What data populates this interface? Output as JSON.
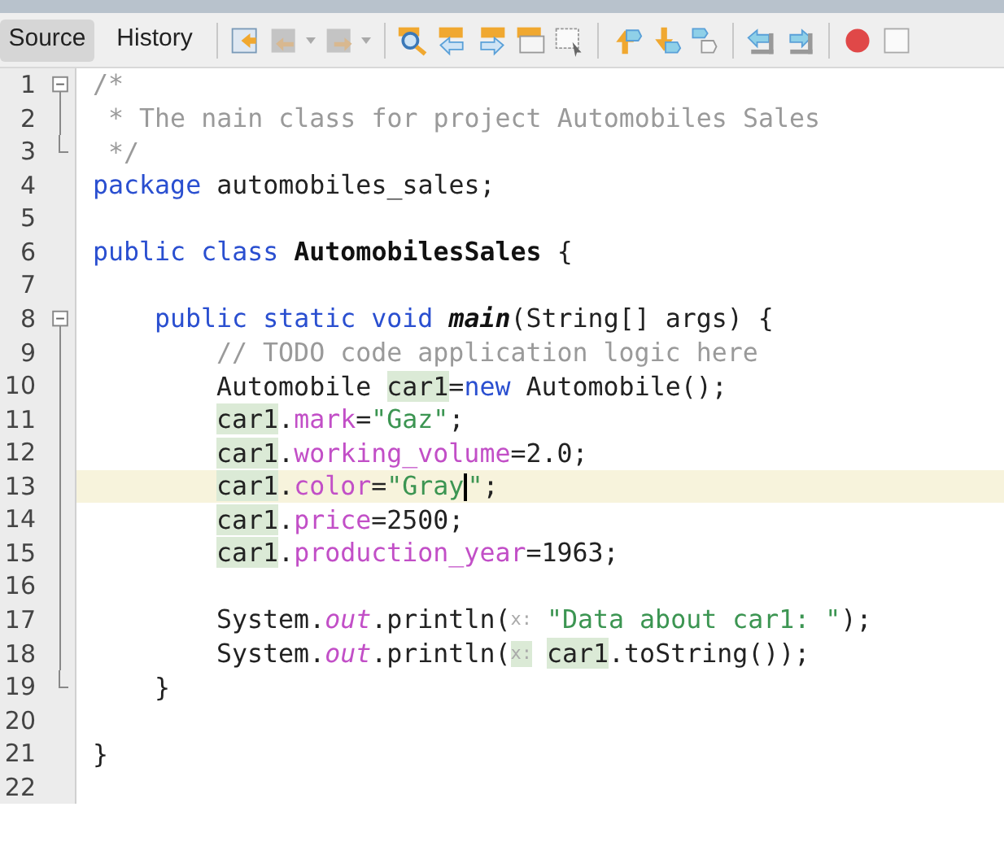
{
  "tabs": [
    {
      "label": "Source",
      "selected": true
    },
    {
      "label": "History",
      "selected": false
    }
  ],
  "toolbar": {
    "back_disabled": true,
    "forward_disabled": true,
    "record_active": true
  },
  "lines": [
    {
      "number": "1",
      "fold_start": true,
      "selected": false,
      "tokens": [
        {
          "kind": "comment",
          "text": "/*"
        }
      ]
    },
    {
      "number": "2",
      "selected": false,
      "tokens": [
        {
          "kind": "comment",
          "text": " * The nain class for project Automobiles Sales"
        }
      ]
    },
    {
      "number": "3",
      "fold_end": true,
      "selected": false,
      "tokens": [
        {
          "kind": "comment",
          "text": " */"
        }
      ]
    },
    {
      "number": "4",
      "selected": false,
      "tokens": [
        {
          "kind": "keyword",
          "text": "package"
        },
        {
          "kind": "plain",
          "text": " automobiles_sales;"
        }
      ]
    },
    {
      "number": "5",
      "selected": false
    },
    {
      "number": "6",
      "selected": false,
      "tokens": [
        {
          "kind": "keyword",
          "text": "public class "
        },
        {
          "kind": "bold",
          "text": "AutomobilesSales"
        },
        {
          "kind": "plain",
          "text": " {"
        }
      ],
      "children": [
        {
          "number": "7",
          "selected": false
        },
        {
          "number": "8",
          "fold_start": true,
          "selected": false,
          "tokens": [
            {
              "kind": "keyword",
              "text": "public static void "
            },
            {
              "kind": "bolditalic",
              "text": "main"
            },
            {
              "kind": "plain",
              "text": "(String[] args) {"
            }
          ],
          "children": [
            {
              "number": "9",
              "selected": false,
              "tokens": [
                {
                  "kind": "comment",
                  "text": "// TODO code application logic here"
                }
              ]
            },
            {
              "number": "10",
              "selected": false,
              "tokens": [
                {
                  "kind": "plain",
                  "text": "Automobile "
                },
                {
                  "kind": "plain",
                  "text": "car1",
                  "marked": true
                },
                {
                  "kind": "plain",
                  "text": "="
                },
                {
                  "kind": "keyword",
                  "text": "new"
                },
                {
                  "kind": "plain",
                  "text": " Automobile();"
                }
              ]
            },
            {
              "number": "11",
              "selected": false,
              "tokens": [
                {
                  "kind": "plain",
                  "text": "car1",
                  "marked": true
                },
                {
                  "kind": "plain",
                  "text": "."
                },
                {
                  "kind": "field",
                  "text": "mark"
                },
                {
                  "kind": "plain",
                  "text": "="
                },
                {
                  "kind": "string",
                  "text": "\"Gaz\""
                },
                {
                  "kind": "plain",
                  "text": ";"
                }
              ]
            },
            {
              "number": "12",
              "selected": false,
              "tokens": [
                {
                  "kind": "plain",
                  "text": "car1",
                  "marked": true
                },
                {
                  "kind": "plain",
                  "text": "."
                },
                {
                  "kind": "field",
                  "text": "working_volume"
                },
                {
                  "kind": "plain",
                  "text": "=2.0;"
                }
              ]
            },
            {
              "number": "13",
              "selected": true,
              "tokens": [
                {
                  "kind": "plain",
                  "text": "car1",
                  "marked": true
                },
                {
                  "kind": "plain",
                  "text": "."
                },
                {
                  "kind": "field",
                  "text": "color"
                },
                {
                  "kind": "plain",
                  "text": "="
                },
                {
                  "kind": "string",
                  "text": "\"Gray",
                  "caret_after": true
                },
                {
                  "kind": "string",
                  "text": "\""
                },
                {
                  "kind": "plain",
                  "text": ";"
                }
              ]
            },
            {
              "number": "14",
              "selected": false,
              "tokens": [
                {
                  "kind": "plain",
                  "text": "car1",
                  "marked": true
                },
                {
                  "kind": "plain",
                  "text": "."
                },
                {
                  "kind": "field",
                  "text": "price"
                },
                {
                  "kind": "plain",
                  "text": "=2500;"
                }
              ]
            },
            {
              "number": "15",
              "selected": false,
              "tokens": [
                {
                  "kind": "plain",
                  "text": "car1",
                  "marked": true
                },
                {
                  "kind": "plain",
                  "text": "."
                },
                {
                  "kind": "field",
                  "text": "production_year"
                },
                {
                  "kind": "plain",
                  "text": "=1963;"
                }
              ]
            },
            {
              "number": "16",
              "selected": false
            },
            {
              "number": "17",
              "selected": false,
              "tokens": [
                {
                  "kind": "plain",
                  "text": "System."
                },
                {
                  "kind": "italic",
                  "text": "out"
                },
                {
                  "kind": "plain",
                  "text": ".println("
                },
                {
                  "kind": "hint",
                  "text": "x:"
                },
                {
                  "kind": "string",
                  "text": "\"Data about car1: \""
                },
                {
                  "kind": "plain",
                  "text": ");"
                }
              ]
            },
            {
              "number": "18",
              "selected": false,
              "tokens": [
                {
                  "kind": "plain",
                  "text": "System."
                },
                {
                  "kind": "italic",
                  "text": "out"
                },
                {
                  "kind": "plain",
                  "text": ".println("
                },
                {
                  "kind": "hint",
                  "text": "x:",
                  "marked": true
                },
                {
                  "kind": "plain",
                  "text": "car1",
                  "marked": true
                },
                {
                  "kind": "plain",
                  "text": ".toString());"
                }
              ]
            }
          ]
        },
        {
          "number": "19",
          "fold_end": true,
          "selected": false,
          "tokens": [
            {
              "kind": "plain",
              "text": "}"
            }
          ]
        },
        {
          "number": "20",
          "selected": false
        }
      ]
    },
    {
      "number": "21",
      "selected": false,
      "tokens": [
        {
          "kind": "plain",
          "text": "}"
        }
      ]
    },
    {
      "number": "22",
      "selected": false
    }
  ]
}
